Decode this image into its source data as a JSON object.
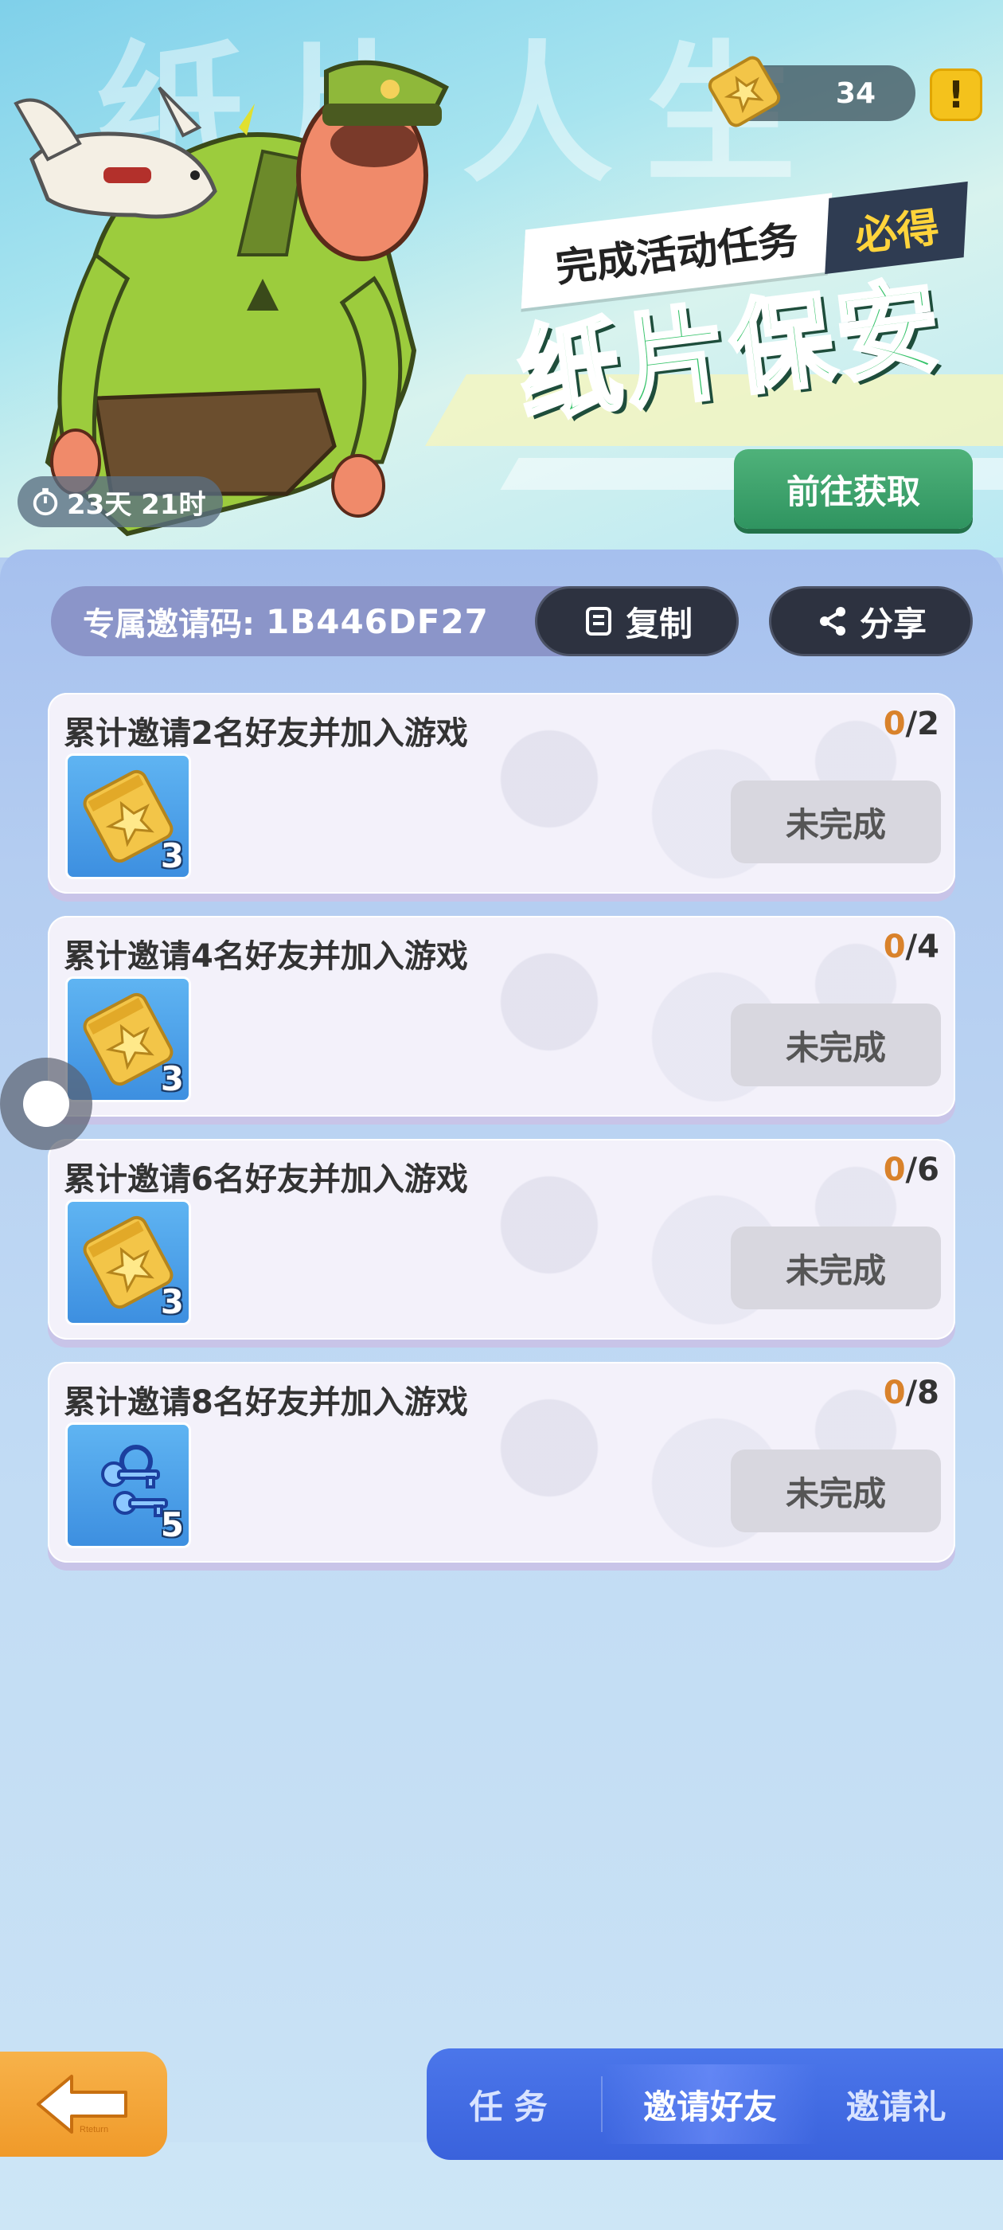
{
  "banner": {
    "background_text": "纸片人生",
    "countdown": "23天 21时",
    "ticket_count": "34",
    "alert_symbol": "!",
    "subtitle": "完成活动任务",
    "badge": "必得",
    "title": "纸片保安",
    "go_button_label": "前往获取"
  },
  "invite": {
    "label": "专属邀请码:",
    "code": "1B446DF27",
    "copy_label": "复制",
    "share_label": "分享"
  },
  "tasks": [
    {
      "title": "累计邀请2名好友并加入游戏",
      "current": "0",
      "total": "/2",
      "reward_icon": "gold-star-ticket",
      "reward_count": "3",
      "status": "未完成"
    },
    {
      "title": "累计邀请4名好友并加入游戏",
      "current": "0",
      "total": "/4",
      "reward_icon": "gold-star-ticket",
      "reward_count": "3",
      "status": "未完成"
    },
    {
      "title": "累计邀请6名好友并加入游戏",
      "current": "0",
      "total": "/6",
      "reward_icon": "gold-star-ticket",
      "reward_count": "3",
      "status": "未完成"
    },
    {
      "title": "累计邀请8名好友并加入游戏",
      "current": "0",
      "total": "/8",
      "reward_icon": "blue-keys",
      "reward_count": "5",
      "status": "未完成"
    }
  ],
  "back_button_text": "Rteturn",
  "tabs": {
    "tasks": "任务",
    "invite_friends": "邀请好友",
    "invite_gift": "邀请礼"
  },
  "colors": {
    "accent_green": "#37c36b",
    "progress_current": "#d9822b",
    "tab_bar": "#3a62dc",
    "back_button": "#f09a2a"
  }
}
